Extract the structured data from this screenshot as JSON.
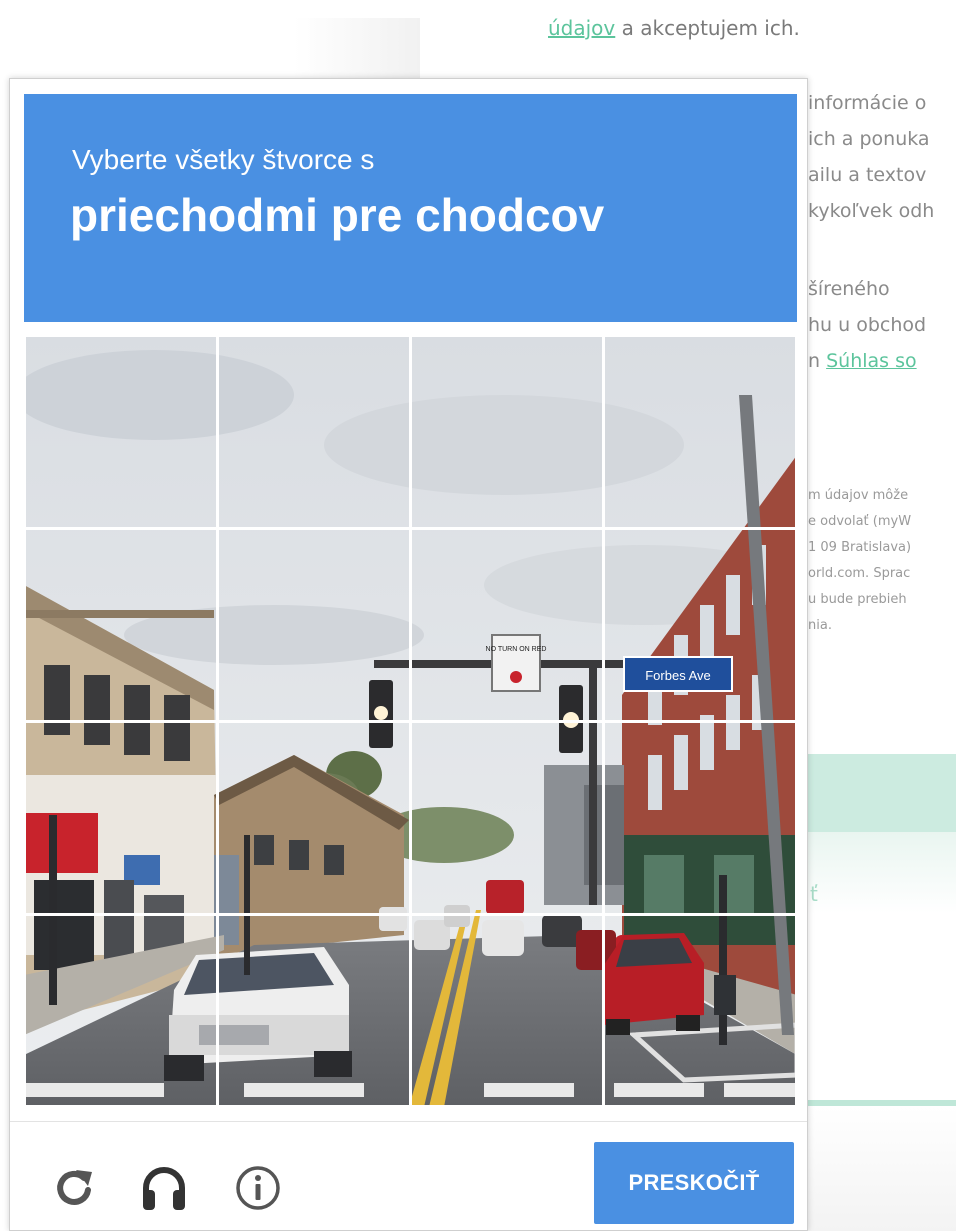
{
  "background": {
    "top_link": "údajov",
    "top_text": " a akceptujem ich.",
    "lines": [
      "informácie o",
      "ich a ponuka",
      "ailu a textov",
      "kykoľvek odh",
      "šíreného",
      "hu u obchod",
      "n "
    ],
    "consent_link": "Súhlas so",
    "small_lines": [
      "m údajov môže",
      "e odvolať (myW",
      "1 09 Bratislava)",
      "orld.com. Sprac",
      "u bude prebieh",
      "nia."
    ],
    "green_char": "ť"
  },
  "captcha": {
    "instruction": "Vyberte všetky štvorce s",
    "keyword": "priechodmi pre chodcov",
    "skip_label": "PRESKOČIŤ",
    "scene_labels": {
      "street_sign": "Forbes Ave",
      "no_turn_sign": "NO TURN ON RED"
    },
    "grid": {
      "rows": 4,
      "cols": 4
    },
    "colors": {
      "accent": "#4a90e2",
      "footer_icon": "#555555"
    }
  }
}
